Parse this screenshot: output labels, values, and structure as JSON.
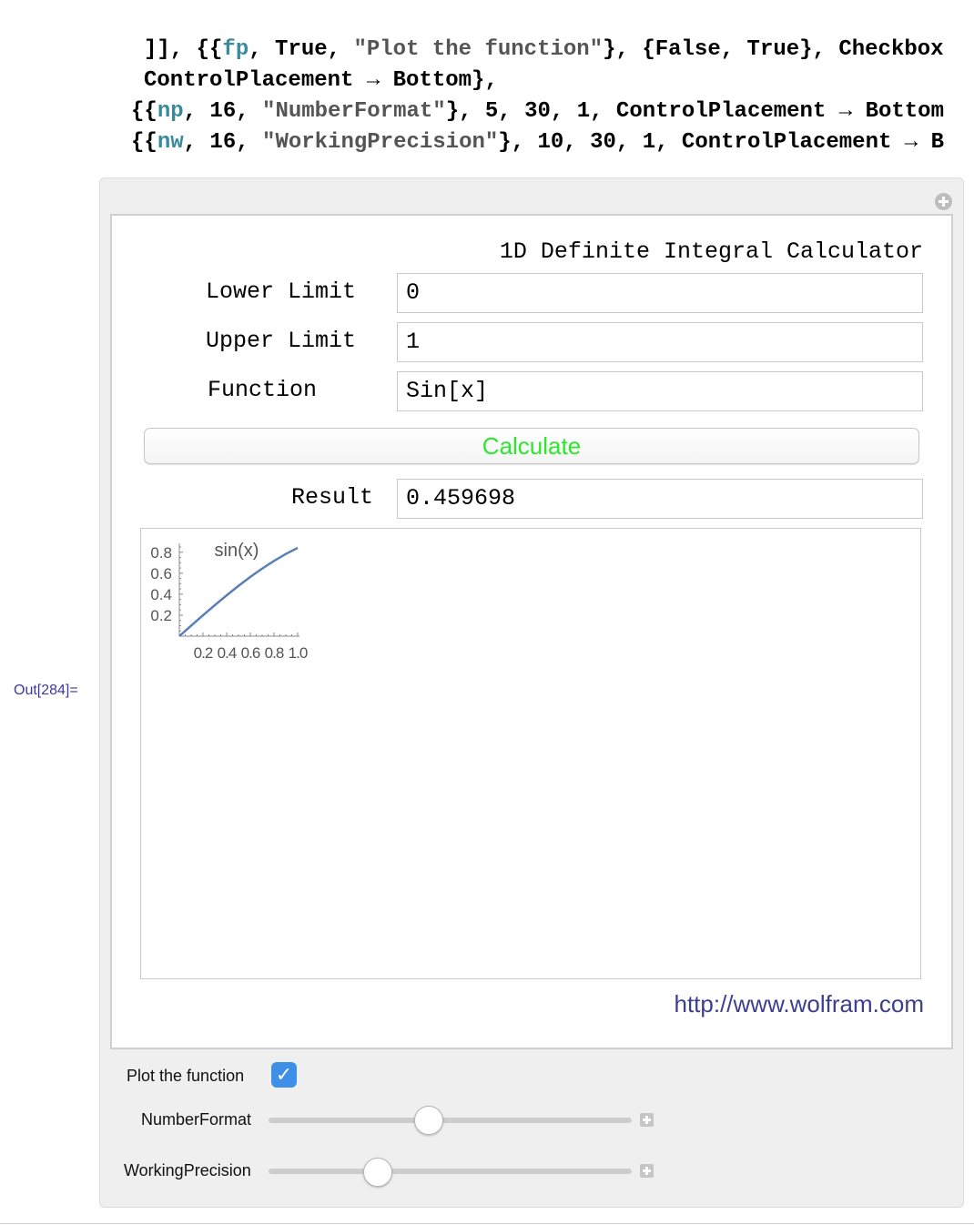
{
  "code": {
    "line1": {
      "a": "]], {{",
      "var": "fp",
      "b": ", True, ",
      "str": "\"Plot the function\"",
      "c": "}, {False, True}, Checkbox"
    },
    "line2": {
      "a": "ControlPlacement → Bottom},"
    },
    "line3": {
      "a": "{{",
      "var": "np",
      "b": ", 16, ",
      "str": "\"NumberFormat\"",
      "c": "}, 5, 30, 1, ControlPlacement → Bottom"
    },
    "line4": {
      "a": "{{",
      "var": "nw",
      "b": ", 16, ",
      "str": "\"WorkingPrecision\"",
      "c": "}, 10, 30, 1, ControlPlacement → B"
    }
  },
  "out_label": "Out[284]=",
  "calculator": {
    "title": "1D Definite Integral Calculator",
    "lower_label": "Lower Limit",
    "lower_value": "0",
    "upper_label": "Upper Limit",
    "upper_value": "1",
    "function_label": "Function",
    "function_value": "Sin[x]",
    "calculate_label": "Calculate",
    "result_label": "Result",
    "result_value": "0.459698",
    "link": "http://www.wolfram.com"
  },
  "chart_data": {
    "type": "line",
    "title": "sin(x)",
    "xlim": [
      0,
      1
    ],
    "ylim": [
      0,
      0.85
    ],
    "x_ticks": [
      "0.2",
      "0.4",
      "0.6",
      "0.8",
      "1.0"
    ],
    "y_ticks": [
      "0.2",
      "0.4",
      "0.6",
      "0.8"
    ],
    "series": [
      {
        "x": [
          0,
          0.1,
          0.2,
          0.3,
          0.4,
          0.5,
          0.6,
          0.7,
          0.8,
          0.9,
          1.0
        ],
        "y": [
          0,
          0.0998,
          0.1987,
          0.2955,
          0.3894,
          0.4794,
          0.5646,
          0.6442,
          0.7174,
          0.7833,
          0.8415
        ]
      }
    ],
    "line_color": "#5a7fb5"
  },
  "controls": {
    "plot_label": "Plot the function",
    "plot_checked": "✓",
    "number_format_label": "NumberFormat",
    "number_format": {
      "value": 16,
      "min": 5,
      "max": 30
    },
    "working_precision_label": "WorkingPrecision",
    "working_precision": {
      "value": 16,
      "min": 10,
      "max": 30
    }
  }
}
